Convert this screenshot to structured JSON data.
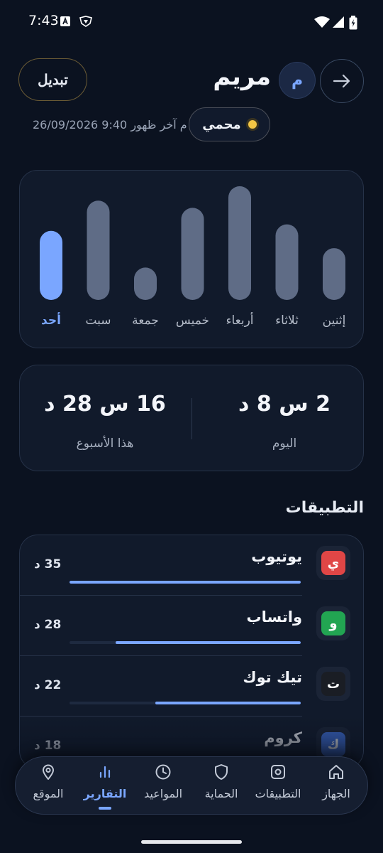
{
  "status_bar": {
    "time": "7:43"
  },
  "header": {
    "switch_label": "تبديل",
    "profile_name": "مريم",
    "avatar_initial": "م",
    "status_label": "محمي",
    "last_seen": "26/09/2026 9:40 م  آخر ظهور"
  },
  "chart_data": {
    "type": "bar",
    "categories": [
      "إثنين",
      "ثلاثاء",
      "أربعاء",
      "خميس",
      "جمعة",
      "سبت",
      "أحد"
    ],
    "values": [
      72,
      105,
      158,
      128,
      45,
      138,
      96
    ],
    "highlight_index": 6,
    "title": "",
    "xlabel": "",
    "ylabel": "",
    "grid": false,
    "colors": {
      "bar": "#5f6c86",
      "highlight": "#7aa6ff",
      "label": "#b6bdca",
      "label_highlight": "#7aa6ff"
    }
  },
  "totals": {
    "today_value": "2 س 8 د",
    "today_label": "اليوم",
    "week_value": "16 س 28 د",
    "week_label": "هذا الأسبوع"
  },
  "apps": {
    "title": "التطبيقات",
    "items": [
      {
        "name": "يوتيوب",
        "initial": "ي",
        "minutes": "35 د",
        "fraction": 1.0,
        "color": "#e04646"
      },
      {
        "name": "واتساب",
        "initial": "و",
        "minutes": "28 د",
        "fraction": 0.8,
        "color": "#22a552"
      },
      {
        "name": "تيك توك",
        "initial": "ت",
        "minutes": "22 د",
        "fraction": 0.63,
        "color": "#1a1d24"
      },
      {
        "name": "كروم",
        "initial": "ك",
        "minutes": "18 د",
        "fraction": 0.51,
        "color": "#3f6fd8"
      }
    ]
  },
  "nav": {
    "items": [
      {
        "label": "الجهاز",
        "icon": "home-icon"
      },
      {
        "label": "التطبيقات",
        "icon": "apps-icon"
      },
      {
        "label": "الحماية",
        "icon": "shield-icon"
      },
      {
        "label": "المواعيد",
        "icon": "clock-icon"
      },
      {
        "label": "التقارير",
        "icon": "bar-chart-icon"
      },
      {
        "label": "الموقع",
        "icon": "location-pin-icon"
      }
    ],
    "active_index": 4
  },
  "colors": {
    "background": "#0b1220",
    "accent": "#7aa6ff",
    "card": "#111a2b"
  }
}
